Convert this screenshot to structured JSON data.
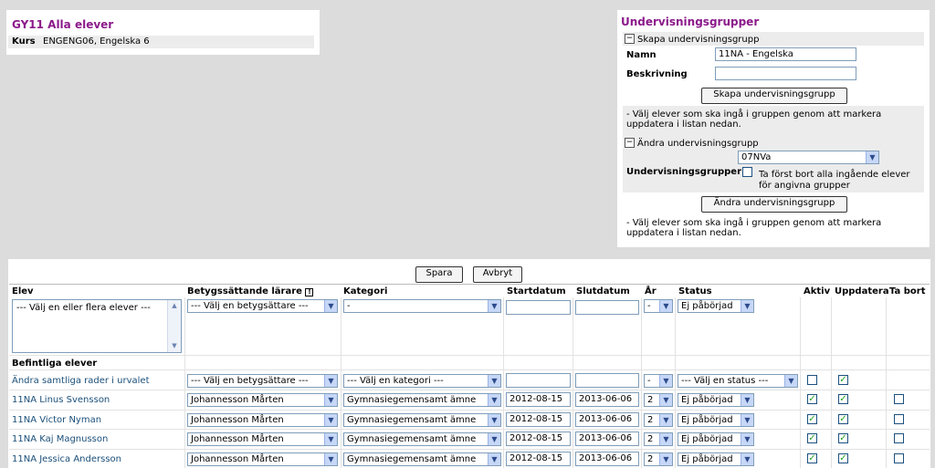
{
  "course": {
    "title": "GY11 Alla elever",
    "kurs_label": "Kurs",
    "kurs_value": "ENGENG06, Engelska 6"
  },
  "groups": {
    "title": "Undervisningsgrupper",
    "create": {
      "heading": "Skapa undervisningsgrupp",
      "name_label": "Namn",
      "name_value": "11NA - Engelska",
      "desc_label": "Beskrivning",
      "desc_value": "",
      "button": "Skapa undervisningsgrupp",
      "hint": "- Välj elever som ska ingå i gruppen genom att markera uppdatera i listan nedan."
    },
    "edit": {
      "heading": "Ändra undervisningsgrupp",
      "groups_label": "Undervisningsgrupper",
      "group_selected": "07NVa",
      "remove_label": "Ta först bort alla ingående elever för angivna grupper",
      "button": "Ändra undervisningsgrupp",
      "hint": "- Välj elever som ska ingå i gruppen genom att markera uppdatera i listan nedan."
    }
  },
  "table": {
    "save": "Spara",
    "cancel": "Avbryt",
    "headers": {
      "elev": "Elev",
      "teacher": "Betygssättande lärare",
      "category": "Kategori",
      "start": "Startdatum",
      "end": "Slutdatum",
      "year": "År",
      "status": "Status",
      "active": "Aktiv",
      "update": "Uppdatera",
      "remove": "Ta bort"
    },
    "new_row": {
      "elev_placeholder": "--- Välj en eller flera elever ---",
      "teacher": "--- Välj en betygsättare ---",
      "category": "-",
      "year": "-",
      "status": "Ej påbörjad"
    },
    "existing_heading": "Befintliga elever",
    "bulk_row": {
      "label": "Ändra samtliga rader i urvalet",
      "teacher": "--- Välj en betygsättare ---",
      "category": "--- Välj en kategori ---",
      "year": "-",
      "status": "--- Välj en status ---",
      "active": false,
      "update": true
    },
    "students": [
      {
        "name": "11NA Linus Svensson",
        "teacher": "Johannesson Mårten",
        "category": "Gymnasiegemensamt ämne",
        "start": "2012-08-15",
        "end": "2013-06-06",
        "year": "2",
        "status": "Ej påbörjad",
        "active": true,
        "update": true,
        "remove": false
      },
      {
        "name": "11NA Victor Nyman",
        "teacher": "Johannesson Mårten",
        "category": "Gymnasiegemensamt ämne",
        "start": "2012-08-15",
        "end": "2013-06-06",
        "year": "2",
        "status": "Ej påbörjad",
        "active": true,
        "update": true,
        "remove": false
      },
      {
        "name": "11NA Kaj Magnusson",
        "teacher": "Johannesson Mårten",
        "category": "Gymnasiegemensamt ämne",
        "start": "2012-08-15",
        "end": "2013-06-06",
        "year": "2",
        "status": "Ej påbörjad",
        "active": true,
        "update": true,
        "remove": false
      },
      {
        "name": "11NA Jessica Andersson",
        "teacher": "Johannesson Mårten",
        "category": "Gymnasiegemensamt ämne",
        "start": "2012-08-15",
        "end": "2013-06-06",
        "year": "2",
        "status": "Ej påbörjad",
        "active": true,
        "update": true,
        "remove": false
      }
    ]
  }
}
